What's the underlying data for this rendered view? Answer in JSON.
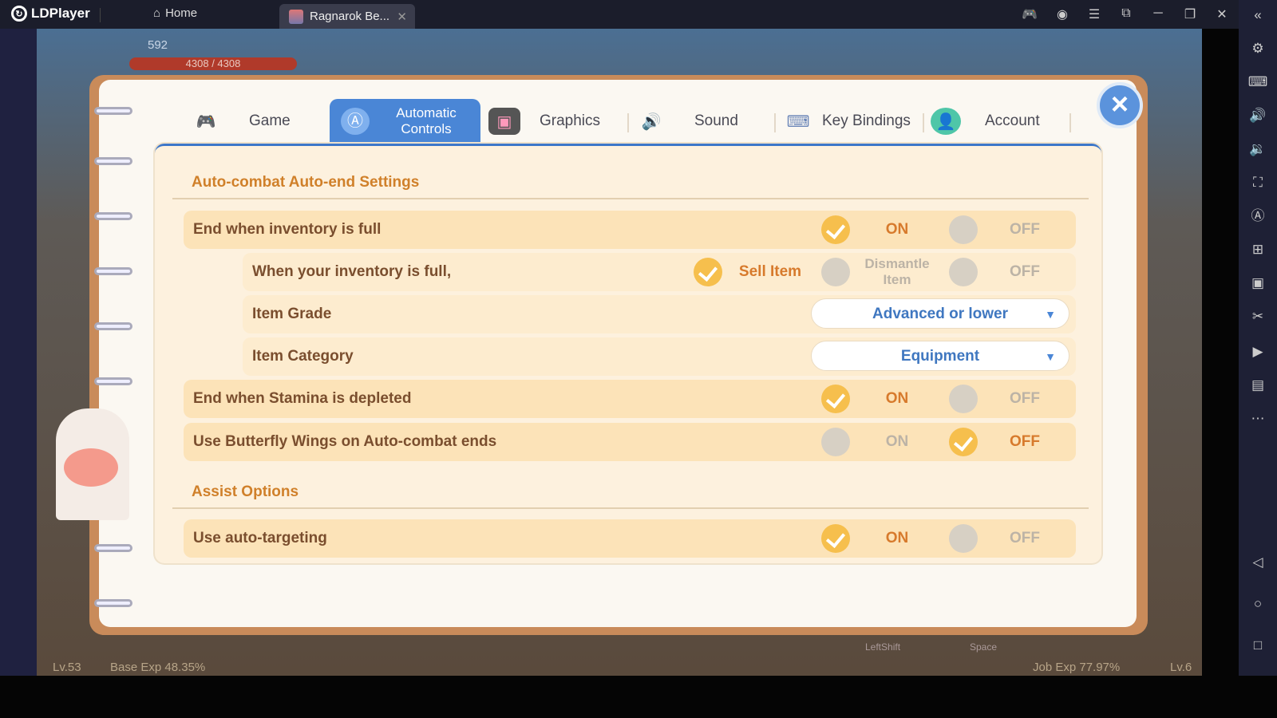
{
  "emulator": {
    "brand": "LDPlayer",
    "home_tab": "Home",
    "game_tab": "Ragnarok Be...",
    "window_controls": [
      "gamepad-icon",
      "account-icon",
      "menu-icon",
      "resize-icon",
      "minimize-icon",
      "restore-icon",
      "close-icon"
    ],
    "sidebar_icons": [
      "settings-icon",
      "keyboard-icon",
      "volume-up-icon",
      "volume-down-icon",
      "screenshot-icon",
      "auto-icon",
      "add-window-icon",
      "apk-icon",
      "scissors-icon",
      "video-icon",
      "files-icon",
      "more-icon",
      "back-icon",
      "home-icon",
      "recent-icon"
    ]
  },
  "hud": {
    "power": "592",
    "hp": "4308 / 4308",
    "level": "Lv.53",
    "base_exp": "Base Exp 48.35%",
    "job_exp": "Job Exp 77.97%",
    "job_level": "Lv.6",
    "key_hints": [
      "LeftShift",
      "Space"
    ]
  },
  "tabs": [
    {
      "label": "Game",
      "icon": "gamepad-icon"
    },
    {
      "label": "Automatic Controls",
      "icon": "auto-icon",
      "active": true
    },
    {
      "label": "Graphics",
      "icon": "monitor-icon"
    },
    {
      "label": "Sound",
      "icon": "speaker-icon"
    },
    {
      "label": "Key Bindings",
      "icon": "keyboard-icon"
    },
    {
      "label": "Account",
      "icon": "account-icon"
    }
  ],
  "sections": {
    "auto_end": "Auto-combat Auto-end Settings",
    "assist": "Assist Options"
  },
  "rows": {
    "inv_full": {
      "label": "End when inventory is full",
      "on": "ON",
      "off": "OFF",
      "value": "ON"
    },
    "when_full": {
      "label": "When your inventory is full,",
      "opt1": "Sell Item",
      "opt2": "Dismantle Item",
      "opt3": "OFF",
      "value": "Sell Item"
    },
    "grade": {
      "label": "Item Grade",
      "value": "Advanced or lower"
    },
    "category": {
      "label": "Item Category",
      "value": "Equipment"
    },
    "stamina": {
      "label": "End when Stamina is depleted",
      "on": "ON",
      "off": "OFF",
      "value": "ON"
    },
    "wings": {
      "label": "Use Butterfly Wings on Auto-combat ends",
      "on": "ON",
      "off": "OFF",
      "value": "OFF"
    },
    "targeting": {
      "label": "Use auto-targeting",
      "on": "ON",
      "off": "OFF",
      "value": "ON"
    }
  },
  "colors": {
    "accent": "#4a86d6",
    "on_text": "#d77a2c",
    "check": "#f6bf4d",
    "row": "#fce3b8"
  }
}
